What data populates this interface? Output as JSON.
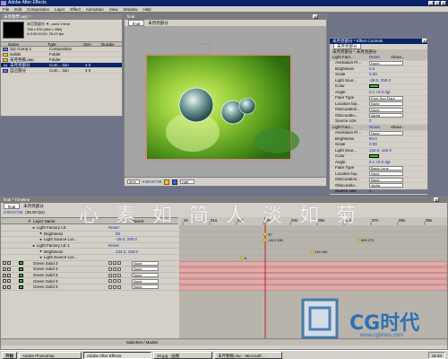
{
  "app": {
    "title": "Adobe After Effects"
  },
  "menu": [
    "File",
    "Edit",
    "Composition",
    "Layer",
    "Effect",
    "Animation",
    "View",
    "Window",
    "Help"
  ],
  "project": {
    "tab": "未亮勒學.aep *",
    "info_line1": "未月亮部分 ▼, used 1 time",
    "info_line2": "768 x 576 (384 x 288)",
    "info_line3": "Δ 0:00:10:00, 25.00 fps",
    "columns": [
      "Name",
      "Type",
      "Size",
      "Duratio"
    ],
    "items": [
      {
        "name": "111 Comp 2",
        "type": "Composition",
        "icon": "composition-icon"
      },
      {
        "name": "Solids",
        "type": "Folder",
        "icon": "folder-icon"
      },
      {
        "name": "未月色稿.aep",
        "type": "Folder",
        "icon": "folder-icon"
      },
      {
        "name": "未月亮部分",
        "type": "Com... tion",
        "size": "4 0",
        "icon": "composition-icon"
      },
      {
        "name": "自己部分",
        "type": "Com... tion",
        "size": "4 0",
        "icon": "composition-icon"
      }
    ]
  },
  "comp": {
    "title": "final",
    "tabs": [
      "final",
      "未月亮部分"
    ],
    "zoom": "50%",
    "timecode": "0:00:07:06",
    "resolution": "Half"
  },
  "effects": {
    "title": "未月亮部分 * Effect Controls",
    "tab": "未月亮部分",
    "layer": "未月亮部分 * 未月亮部分",
    "groups": [
      {
        "name": "Light Fact...",
        "reset": "Reset",
        "about": "About...",
        "rows": [
          {
            "label": "Animation Pr...",
            "value": "None",
            "kind": "dropdown"
          },
          {
            "label": "Brightness",
            "value": "0.0"
          },
          {
            "label": "Scale",
            "value": "0.00"
          },
          {
            "label": "Light Sour...",
            "value": "-28.0, 250.0"
          },
          {
            "label": "Color",
            "value": "",
            "kind": "swatch"
          },
          {
            "label": "Angle",
            "value": "0 x +0.0 dgr"
          },
          {
            "label": "Flare Type",
            "value": "Pure Sun Flare",
            "kind": "dropdown"
          },
          {
            "label": "Location lay...",
            "value": "None",
            "kind": "dropdown"
          },
          {
            "label": "Obscuration...",
            "value": "None",
            "kind": "dropdown"
          },
          {
            "label": "Obscuratio...",
            "value": "Alpha",
            "kind": "dropdown"
          },
          {
            "label": "Source size",
            "value": "0"
          }
        ]
      },
      {
        "name": "Light Fact...",
        "reset": "Reset",
        "about": "About...",
        "rows": [
          {
            "label": "Animation Pr...",
            "value": "None",
            "kind": "dropdown"
          },
          {
            "label": "Brightness",
            "value": "90.0"
          },
          {
            "label": "Scale",
            "value": "0.00"
          },
          {
            "label": "Light Sour...",
            "value": "134.0, 160.0"
          },
          {
            "label": "Color",
            "value": "",
            "kind": "swatch"
          },
          {
            "label": "Angle",
            "value": "0 x +0.0 dgr"
          },
          {
            "label": "Flare Type",
            "value": "Basic Lens",
            "kind": "dropdown"
          },
          {
            "label": "Location lay...",
            "value": "None",
            "kind": "dropdown"
          },
          {
            "label": "Obscuration...",
            "value": "None",
            "kind": "dropdown"
          },
          {
            "label": "Obscuratio...",
            "value": "Alpha",
            "kind": "dropdown"
          },
          {
            "label": "Source size",
            "value": "2"
          }
        ]
      }
    ]
  },
  "timeline": {
    "title": "final * Timeline",
    "tabs": [
      "final",
      "未月亮部分"
    ],
    "timecode": "0:00:07:06",
    "fps": "(25.00 fps)",
    "columns": [
      "#",
      "Layer Name",
      "Parent"
    ],
    "ticks": [
      "0s",
      "01s",
      "02s",
      "03s",
      "04s",
      "05s",
      "06s",
      "07s",
      "08s",
      "09s"
    ],
    "rows": [
      {
        "label": "Light Factory LE",
        "value": "Reset",
        "kind": "effect"
      },
      {
        "label": "Brightness",
        "value": "90",
        "kind": "prop"
      },
      {
        "label": "Light Source Loc...",
        "value": "-28.0, 250.0",
        "kind": "prop"
      },
      {
        "label": "Light Factory LE 1",
        "value": "Reset",
        "kind": "effect"
      },
      {
        "label": "Brightness",
        "value": "134.0, 160.0",
        "kind": "prop"
      },
      {
        "label": "Light Source Loc...",
        "value": "",
        "kind": "prop"
      },
      {
        "label": "Green Solid 3",
        "parent": "None",
        "kind": "layer"
      },
      {
        "label": "Green Solid 3",
        "parent": "None",
        "kind": "layer"
      },
      {
        "label": "Green Solid 3",
        "parent": "None",
        "kind": "layer"
      },
      {
        "label": "Green Solid 3",
        "parent": "None",
        "kind": "layer"
      },
      {
        "label": "Green Solid 3",
        "parent": "None",
        "kind": "layer"
      }
    ],
    "keyframe_labels": [
      "30",
      "-28.0 250",
      "800 270",
      "134 160",
      "d"
    ],
    "footer": "Switches / Modes"
  },
  "watermark": {
    "calligraphy": "心 素 如 简 人 淡 如 菊",
    "logo": "CG时代",
    "url": "www.cgtimes.com"
  },
  "taskbar": {
    "start": "开始",
    "buttons": [
      "Adobe Photoshop",
      "Adobe After Effects",
      "30.jpg - 画图",
      "未月勒稿.doc - Microsoft ..."
    ],
    "clock": "15:34"
  }
}
